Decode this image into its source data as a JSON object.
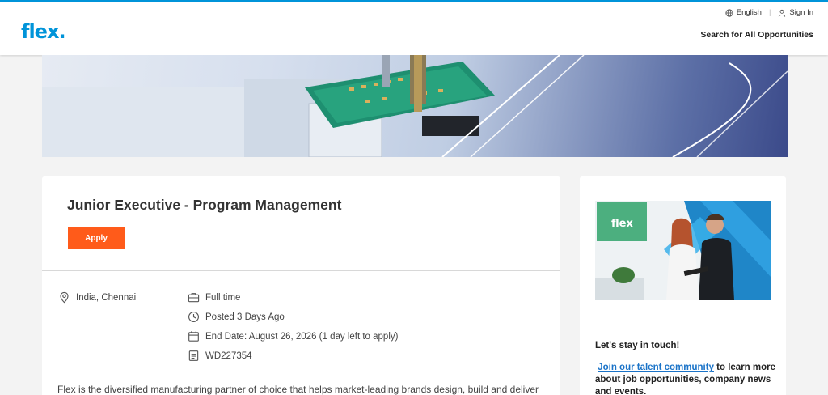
{
  "header": {
    "logo": "flex",
    "language": "English",
    "sign_in": "Sign In",
    "search_link": "Search for All Opportunities"
  },
  "job": {
    "title": "Junior Executive - Program Management",
    "apply_label": "Apply",
    "location": "India, Chennai",
    "type": "Full time",
    "posted": "Posted 3 Days Ago",
    "end_date": "End Date: August 26, 2026 (1 day left to apply)",
    "job_id": "WD227354",
    "description": "Flex is the diversified manufacturing partner of choice that helps market-leading brands design, build and deliver"
  },
  "sidebar": {
    "photo_logo": "flex",
    "heading": "Let's stay in touch!",
    "link_text": "Join our talent community",
    "body_text": " to learn more about job opportunities, company news and events."
  },
  "colors": {
    "accent": "#0094d9",
    "apply": "#ff5b1a",
    "link": "#1a73c8"
  }
}
